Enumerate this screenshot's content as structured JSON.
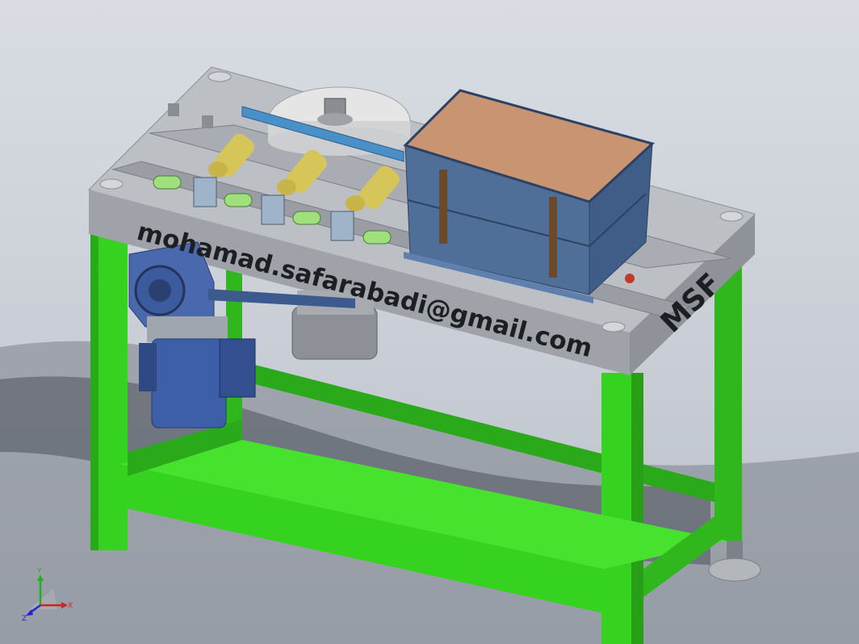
{
  "viewport": {
    "background_top": "#d9dde3",
    "background_bottom": "#b8bec7"
  },
  "model": {
    "table_top_label": "mohamad.safarabadi@gmail.com",
    "side_label": "MSF",
    "colors": {
      "frame": "#35d21f",
      "frame_dark": "#1f9a13",
      "table_top": "#bcbfc4",
      "motor_blue": "#3c5fa8",
      "hopper_blue": "#4f6f99",
      "hopper_lid": "#c99472",
      "roller_yellow": "#d6c65a"
    }
  },
  "triad": {
    "x_label": "X",
    "y_label": "Y",
    "z_label": "Z",
    "x_icon": "x-axis-arrow-icon",
    "y_icon": "y-axis-arrow-icon",
    "z_icon": "z-axis-arrow-icon"
  }
}
